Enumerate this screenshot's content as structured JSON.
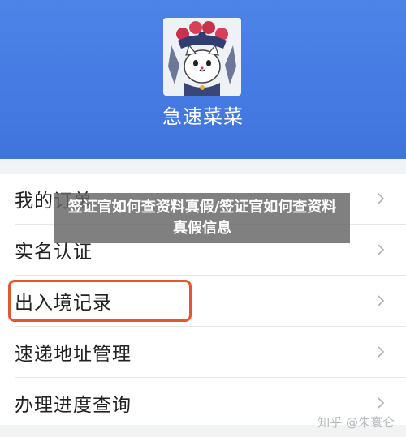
{
  "profile": {
    "avatar_icon": "opera-mask-cat-avatar",
    "username": "急速菜菜"
  },
  "menu": {
    "items": [
      {
        "label": "我的订单",
        "icon": "chevron-right-icon"
      },
      {
        "label": "实名认证",
        "icon": "chevron-right-icon"
      },
      {
        "label": "出入境记录",
        "icon": "chevron-right-icon",
        "highlighted": true
      },
      {
        "label": "速递地址管理",
        "icon": "chevron-right-icon"
      },
      {
        "label": "办理进度查询",
        "icon": "chevron-right-icon"
      }
    ]
  },
  "overlay": {
    "title": "签证官如何查资料真假/签证官如何查资料真假信息"
  },
  "watermark": "知乎 @朱寰仑",
  "colors": {
    "header_blue": "#4279e2",
    "highlight_red": "#e2572f",
    "overlay_gray": "#646464"
  }
}
